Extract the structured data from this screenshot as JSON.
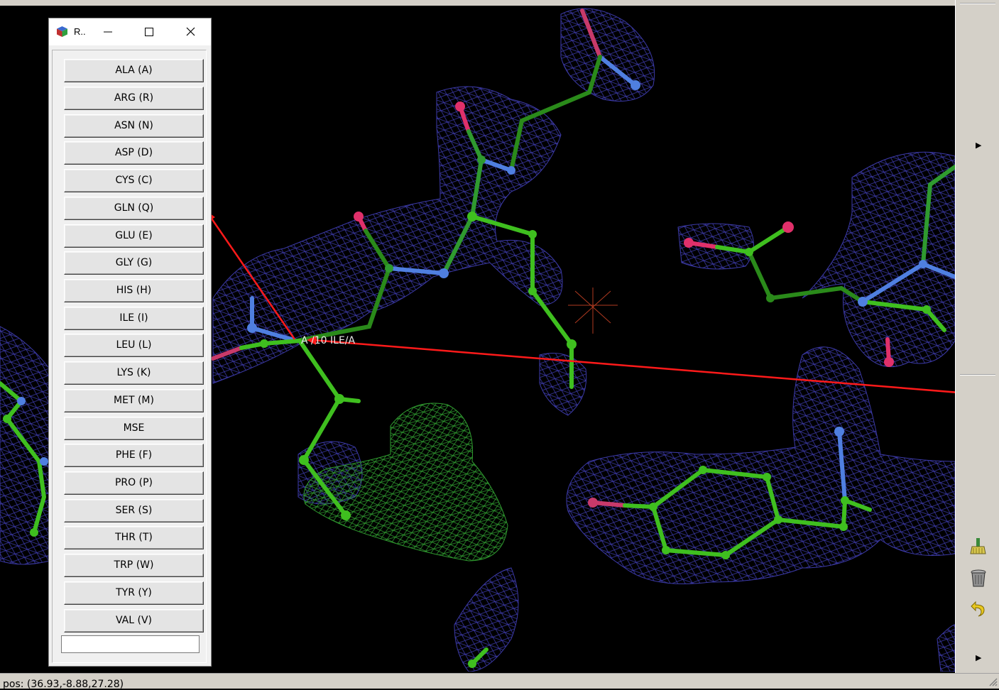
{
  "window": {
    "title": "R.."
  },
  "residue_buttons": [
    "ALA (A)",
    "ARG (R)",
    "ASN (N)",
    "ASP (D)",
    "CYS (C)",
    "GLN (Q)",
    "GLU (E)",
    "GLY (G)",
    "HIS (H)",
    "ILE (I)",
    "LEU (L)",
    "LYS (K)",
    "MET (M)",
    "MSE",
    "PHE (F)",
    "PRO (P)",
    "SER (S)",
    "THR (T)",
    "TRP (W)",
    "TYR (Y)",
    "VAL (V)"
  ],
  "residue_entry": {
    "value": ""
  },
  "atom_label": "A /10 ILE/A",
  "status": {
    "text": "pos: (36.93,-8.88,27.28)"
  },
  "icons": {
    "app": "coot-cube-icon",
    "minimize": "minimize-icon",
    "maximize": "maximize-icon",
    "close": "close-icon",
    "broom": "broom-icon",
    "trash": "trash-icon",
    "undo": "undo-icon"
  },
  "colors": {
    "background": "#000000",
    "density_map": "#3c3aa8",
    "difference_map": "#2f9a2f",
    "carbon": "#3fbf1f",
    "nitrogen": "#4f7fe0",
    "oxygen": "#e0306a",
    "annotation_arrow": "#ff1a1a"
  }
}
